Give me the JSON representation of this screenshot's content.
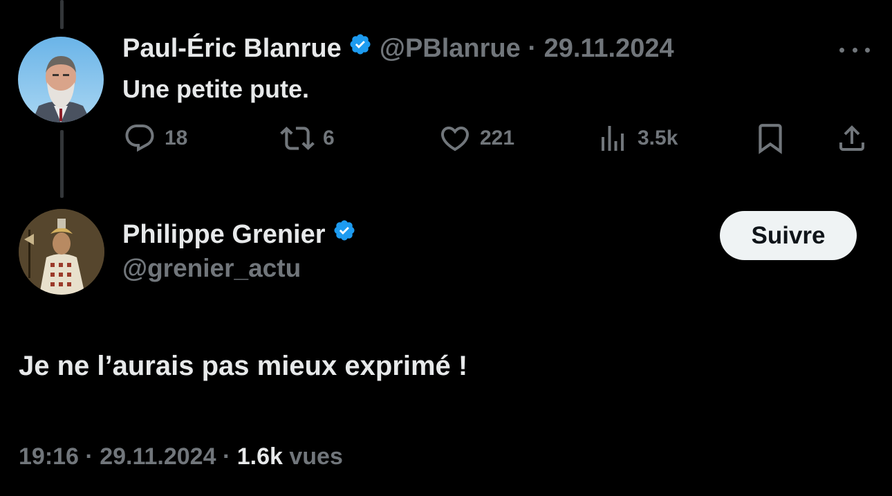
{
  "parent_tweet": {
    "author_name": "Paul-Éric Blanrue",
    "handle": "@PBlanrue",
    "separator": "·",
    "date": "29.11.2024",
    "text": "Une petite pute.",
    "replies": "18",
    "reposts": "6",
    "likes": "221",
    "views": "3.5k",
    "verified": true
  },
  "main_tweet": {
    "author_name": "Philippe Grenier",
    "handle": "@grenier_actu",
    "follow_label": "Suivre",
    "text": "Je ne l’aurais pas mieux exprimé !",
    "time": "19:16",
    "sep1": "·",
    "date": "29.11.2024",
    "sep2": "·",
    "views_count": "1.6k",
    "views_label": "vues",
    "verified": true
  },
  "icons": {
    "reply": "reply-icon",
    "repost": "repost-icon",
    "like": "heart-icon",
    "views": "analytics-icon",
    "bookmark": "bookmark-icon",
    "share": "share-icon",
    "more": "more-icon",
    "verified": "verified-badge-icon"
  },
  "colors": {
    "background": "#000000",
    "primary_text": "#e7e9ea",
    "secondary_text": "#71767b",
    "verified_blue": "#1d9bf0",
    "follow_button_bg": "#eff3f4",
    "thread_line": "#333639"
  }
}
